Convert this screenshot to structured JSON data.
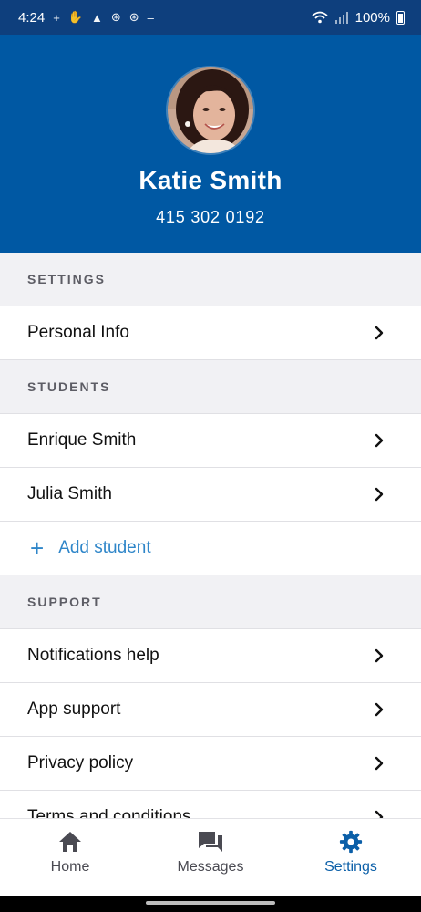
{
  "status_bar": {
    "time": "4:24",
    "battery_text": "100%",
    "left_icons": [
      "plus-icon",
      "hand-icon",
      "warning-icon",
      "sync-icon",
      "sync-icon",
      "minus-icon"
    ],
    "right_icons": [
      "wifi-icon",
      "signal-icon",
      "battery-icon"
    ]
  },
  "profile": {
    "name": "Katie Smith",
    "phone": "415 302 0192"
  },
  "sections": {
    "settings": {
      "header": "SETTINGS",
      "items": [
        "Personal Info"
      ]
    },
    "students": {
      "header": "STUDENTS",
      "items": [
        "Enrique Smith",
        "Julia Smith"
      ],
      "add_label": "Add student"
    },
    "support": {
      "header": "SUPPORT",
      "items": [
        "Notifications help",
        "App support",
        "Privacy policy",
        "Terms and conditions"
      ]
    }
  },
  "bottom_nav": {
    "home": "Home",
    "messages": "Messages",
    "settings": "Settings",
    "active": "settings"
  },
  "colors": {
    "status_bar": "#0e3f7d",
    "header_blue": "#0058a3",
    "accent": "#2f86c9",
    "active_nav": "#0b5fa8",
    "section_bg": "#f1f1f4"
  }
}
